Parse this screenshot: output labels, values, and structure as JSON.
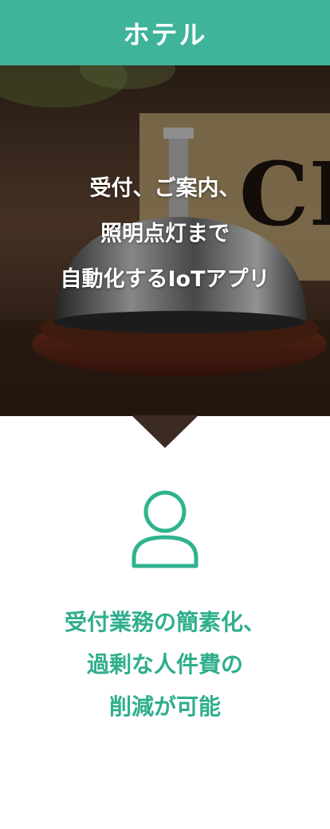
{
  "header": {
    "title": "ホテル"
  },
  "hero": {
    "lines": [
      "受付、ご案内、",
      "照明点灯まで",
      "自動化するIoTアプリ"
    ],
    "sign_text": "CI"
  },
  "benefit": {
    "icon": "user-icon",
    "lines": [
      "受付業務の簡素化、",
      "過剰な人件費の",
      "削減が可能"
    ]
  },
  "colors": {
    "accent": "#3fb49a",
    "benefit_text": "#2fae8d",
    "icon": "#2fb38f"
  }
}
